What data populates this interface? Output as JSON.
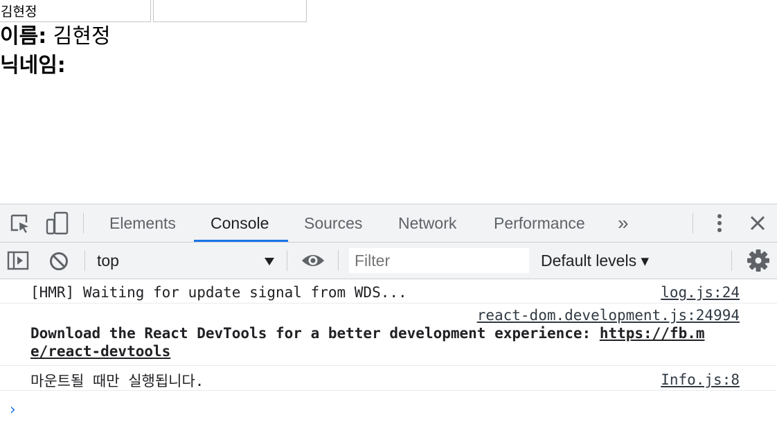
{
  "app": {
    "name_input_value": "김현정",
    "nickname_input_value": "",
    "name_label": "이름:",
    "name_value": "김현정",
    "nickname_label": "닉네임:",
    "nickname_value": ""
  },
  "devtools": {
    "tabs": [
      {
        "label": "Elements"
      },
      {
        "label": "Console"
      },
      {
        "label": "Sources"
      },
      {
        "label": "Network"
      },
      {
        "label": "Performance"
      }
    ],
    "more_tabs_label": "»",
    "active_tab": "Console",
    "accent_color": "#1a73e8",
    "toolbar": {
      "context": "top",
      "filter_placeholder": "Filter",
      "levels": "Default levels ▾"
    },
    "messages": [
      {
        "text": "[HMR] Waiting for update signal from WDS...",
        "source": "log.js:24"
      },
      {
        "source": "react-dom.development.js:24994",
        "text_bold": "Download the React DevTools for a better development experience: ",
        "link_part1": "https://fb.m",
        "link_part2": "e/react-devtools"
      },
      {
        "text": "마운트될 때만 실행됩니다.",
        "source": "Info.js:8"
      }
    ],
    "prompt": "›"
  }
}
